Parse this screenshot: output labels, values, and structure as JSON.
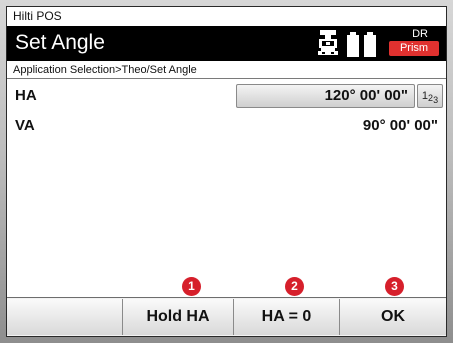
{
  "app": {
    "title": "Hilti POS"
  },
  "header": {
    "title": "Set Angle",
    "icons": [
      "instrument-icon",
      "battery-icon"
    ],
    "dr_label": "DR",
    "target_label": "Prism",
    "colors": {
      "bar": "#000000",
      "badge": "#e0312f"
    }
  },
  "breadcrumb": "Application Selection>Theo/Set Angle",
  "fields": {
    "ha": {
      "label": "HA",
      "value": "120° 00' 00\"",
      "mode_label_main": "1",
      "mode_label_sub": "2",
      "mode_label_sub2": "3"
    },
    "va": {
      "label": "VA",
      "value": "90° 00' 00\""
    }
  },
  "markers": [
    "1",
    "2",
    "3"
  ],
  "softkeys": [
    "",
    "Hold HA",
    "HA = 0",
    "OK"
  ]
}
